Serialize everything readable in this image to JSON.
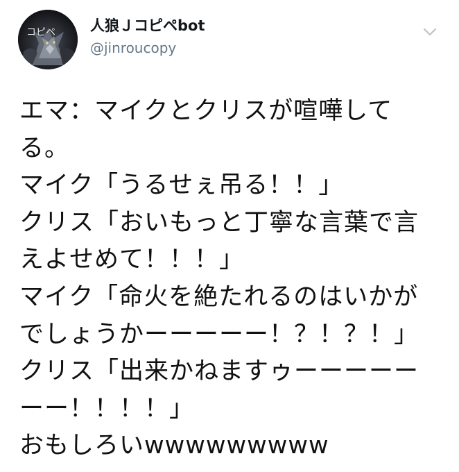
{
  "account": {
    "avatar_text": "コピペ",
    "display_name": "人狼Ｊコピペbot",
    "handle": "@jinroucopy"
  },
  "icons": {
    "menu": "chevron-down-icon"
  },
  "colors": {
    "text": "#111111",
    "handle": "#657786",
    "chevron": "#b8c0c8"
  },
  "tweet": {
    "lines": [
      "エマ：マイクとクリスが喧嘩して",
      "る。",
      "マイク「うるせぇ吊る！！」",
      "クリス「おいもっと丁寧な言葉で言",
      "えよせめて！！！」",
      "マイク「命火を絶たれるのはいかが",
      "でしょうかーーーーー！？！？！」",
      "クリス「出来かねますゥーーーーー",
      "ーー！！！！」",
      "おもしろいwwwwwwwww"
    ]
  }
}
